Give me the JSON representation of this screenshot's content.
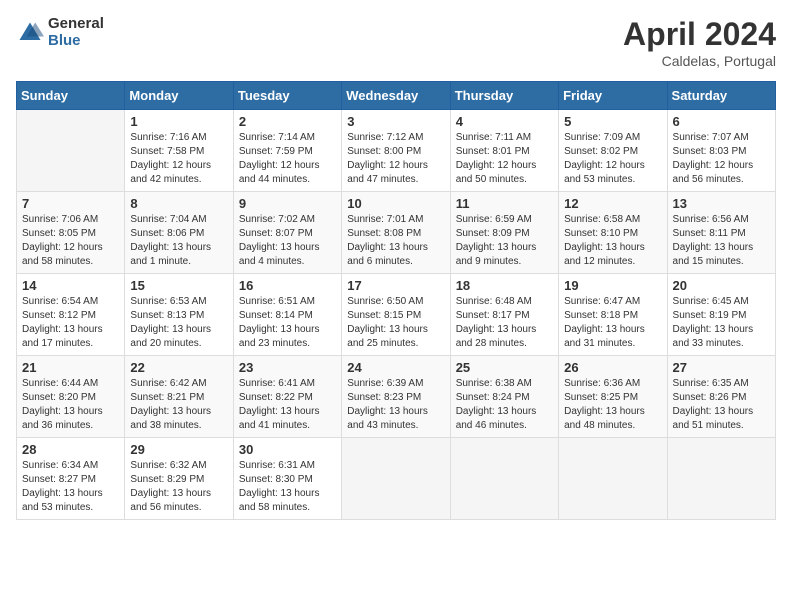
{
  "logo": {
    "general": "General",
    "blue": "Blue"
  },
  "title": {
    "month": "April 2024",
    "location": "Caldelas, Portugal"
  },
  "weekdays": [
    "Sunday",
    "Monday",
    "Tuesday",
    "Wednesday",
    "Thursday",
    "Friday",
    "Saturday"
  ],
  "weeks": [
    [
      {
        "day": "",
        "sunrise": "",
        "sunset": "",
        "daylight": ""
      },
      {
        "day": "1",
        "sunrise": "Sunrise: 7:16 AM",
        "sunset": "Sunset: 7:58 PM",
        "daylight": "Daylight: 12 hours and 42 minutes."
      },
      {
        "day": "2",
        "sunrise": "Sunrise: 7:14 AM",
        "sunset": "Sunset: 7:59 PM",
        "daylight": "Daylight: 12 hours and 44 minutes."
      },
      {
        "day": "3",
        "sunrise": "Sunrise: 7:12 AM",
        "sunset": "Sunset: 8:00 PM",
        "daylight": "Daylight: 12 hours and 47 minutes."
      },
      {
        "day": "4",
        "sunrise": "Sunrise: 7:11 AM",
        "sunset": "Sunset: 8:01 PM",
        "daylight": "Daylight: 12 hours and 50 minutes."
      },
      {
        "day": "5",
        "sunrise": "Sunrise: 7:09 AM",
        "sunset": "Sunset: 8:02 PM",
        "daylight": "Daylight: 12 hours and 53 minutes."
      },
      {
        "day": "6",
        "sunrise": "Sunrise: 7:07 AM",
        "sunset": "Sunset: 8:03 PM",
        "daylight": "Daylight: 12 hours and 56 minutes."
      }
    ],
    [
      {
        "day": "7",
        "sunrise": "Sunrise: 7:06 AM",
        "sunset": "Sunset: 8:05 PM",
        "daylight": "Daylight: 12 hours and 58 minutes."
      },
      {
        "day": "8",
        "sunrise": "Sunrise: 7:04 AM",
        "sunset": "Sunset: 8:06 PM",
        "daylight": "Daylight: 13 hours and 1 minute."
      },
      {
        "day": "9",
        "sunrise": "Sunrise: 7:02 AM",
        "sunset": "Sunset: 8:07 PM",
        "daylight": "Daylight: 13 hours and 4 minutes."
      },
      {
        "day": "10",
        "sunrise": "Sunrise: 7:01 AM",
        "sunset": "Sunset: 8:08 PM",
        "daylight": "Daylight: 13 hours and 6 minutes."
      },
      {
        "day": "11",
        "sunrise": "Sunrise: 6:59 AM",
        "sunset": "Sunset: 8:09 PM",
        "daylight": "Daylight: 13 hours and 9 minutes."
      },
      {
        "day": "12",
        "sunrise": "Sunrise: 6:58 AM",
        "sunset": "Sunset: 8:10 PM",
        "daylight": "Daylight: 13 hours and 12 minutes."
      },
      {
        "day": "13",
        "sunrise": "Sunrise: 6:56 AM",
        "sunset": "Sunset: 8:11 PM",
        "daylight": "Daylight: 13 hours and 15 minutes."
      }
    ],
    [
      {
        "day": "14",
        "sunrise": "Sunrise: 6:54 AM",
        "sunset": "Sunset: 8:12 PM",
        "daylight": "Daylight: 13 hours and 17 minutes."
      },
      {
        "day": "15",
        "sunrise": "Sunrise: 6:53 AM",
        "sunset": "Sunset: 8:13 PM",
        "daylight": "Daylight: 13 hours and 20 minutes."
      },
      {
        "day": "16",
        "sunrise": "Sunrise: 6:51 AM",
        "sunset": "Sunset: 8:14 PM",
        "daylight": "Daylight: 13 hours and 23 minutes."
      },
      {
        "day": "17",
        "sunrise": "Sunrise: 6:50 AM",
        "sunset": "Sunset: 8:15 PM",
        "daylight": "Daylight: 13 hours and 25 minutes."
      },
      {
        "day": "18",
        "sunrise": "Sunrise: 6:48 AM",
        "sunset": "Sunset: 8:17 PM",
        "daylight": "Daylight: 13 hours and 28 minutes."
      },
      {
        "day": "19",
        "sunrise": "Sunrise: 6:47 AM",
        "sunset": "Sunset: 8:18 PM",
        "daylight": "Daylight: 13 hours and 31 minutes."
      },
      {
        "day": "20",
        "sunrise": "Sunrise: 6:45 AM",
        "sunset": "Sunset: 8:19 PM",
        "daylight": "Daylight: 13 hours and 33 minutes."
      }
    ],
    [
      {
        "day": "21",
        "sunrise": "Sunrise: 6:44 AM",
        "sunset": "Sunset: 8:20 PM",
        "daylight": "Daylight: 13 hours and 36 minutes."
      },
      {
        "day": "22",
        "sunrise": "Sunrise: 6:42 AM",
        "sunset": "Sunset: 8:21 PM",
        "daylight": "Daylight: 13 hours and 38 minutes."
      },
      {
        "day": "23",
        "sunrise": "Sunrise: 6:41 AM",
        "sunset": "Sunset: 8:22 PM",
        "daylight": "Daylight: 13 hours and 41 minutes."
      },
      {
        "day": "24",
        "sunrise": "Sunrise: 6:39 AM",
        "sunset": "Sunset: 8:23 PM",
        "daylight": "Daylight: 13 hours and 43 minutes."
      },
      {
        "day": "25",
        "sunrise": "Sunrise: 6:38 AM",
        "sunset": "Sunset: 8:24 PM",
        "daylight": "Daylight: 13 hours and 46 minutes."
      },
      {
        "day": "26",
        "sunrise": "Sunrise: 6:36 AM",
        "sunset": "Sunset: 8:25 PM",
        "daylight": "Daylight: 13 hours and 48 minutes."
      },
      {
        "day": "27",
        "sunrise": "Sunrise: 6:35 AM",
        "sunset": "Sunset: 8:26 PM",
        "daylight": "Daylight: 13 hours and 51 minutes."
      }
    ],
    [
      {
        "day": "28",
        "sunrise": "Sunrise: 6:34 AM",
        "sunset": "Sunset: 8:27 PM",
        "daylight": "Daylight: 13 hours and 53 minutes."
      },
      {
        "day": "29",
        "sunrise": "Sunrise: 6:32 AM",
        "sunset": "Sunset: 8:29 PM",
        "daylight": "Daylight: 13 hours and 56 minutes."
      },
      {
        "day": "30",
        "sunrise": "Sunrise: 6:31 AM",
        "sunset": "Sunset: 8:30 PM",
        "daylight": "Daylight: 13 hours and 58 minutes."
      },
      {
        "day": "",
        "sunrise": "",
        "sunset": "",
        "daylight": ""
      },
      {
        "day": "",
        "sunrise": "",
        "sunset": "",
        "daylight": ""
      },
      {
        "day": "",
        "sunrise": "",
        "sunset": "",
        "daylight": ""
      },
      {
        "day": "",
        "sunrise": "",
        "sunset": "",
        "daylight": ""
      }
    ]
  ]
}
